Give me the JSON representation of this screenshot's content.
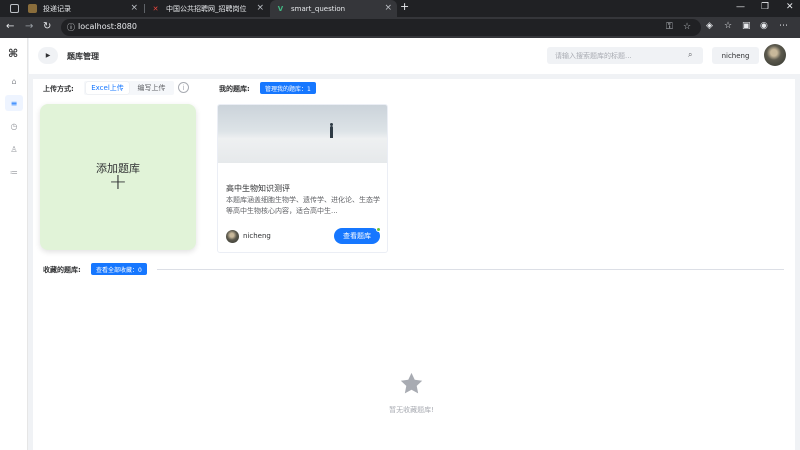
{
  "browser": {
    "tabs": [
      {
        "title": "投递记录",
        "active": false
      },
      {
        "title": "中国公共招聘网_招聘岗位",
        "active": false
      },
      {
        "title": "smart_question",
        "active": true
      }
    ],
    "new_tab": "+",
    "url": "localhost:8080"
  },
  "sidebar": {
    "logo": "⌘",
    "items": [
      {
        "icon": "home-icon",
        "glyph": "⌂",
        "active": false
      },
      {
        "icon": "list-icon",
        "glyph": "≡",
        "active": true
      },
      {
        "icon": "clock-icon",
        "glyph": "◷",
        "active": false
      },
      {
        "icon": "flask-icon",
        "glyph": "♙",
        "active": false
      },
      {
        "icon": "sort-icon",
        "glyph": "≔",
        "active": false
      }
    ]
  },
  "header": {
    "toggle_glyph": "▶",
    "title": "题库管理",
    "search_placeholder": "请输入搜索题库的标题...",
    "search_glyph": "⌕",
    "username": "nicheng"
  },
  "upload": {
    "label": "上传方式:",
    "options": [
      "Excel上传",
      "编写上传"
    ],
    "selected": "Excel上传",
    "info_glyph": "i"
  },
  "my_banks": {
    "label": "我的题库:",
    "manage_tag": "管理我的题库：1"
  },
  "add_card": {
    "label": "添加题库",
    "plus": "+"
  },
  "bank": {
    "title": "高中生物知识测评",
    "description": "本题库涵盖细胞生物学、遗传学、进化论、生态学等高中生物核心内容，适合高中生...",
    "owner": "nicheng",
    "view_label": "查看题库"
  },
  "favorites": {
    "label": "收藏的题库:",
    "view_all_tag": "查看全部收藏：0",
    "empty_text": "暂无收藏题库!"
  },
  "colors": {
    "primary": "#1677ff",
    "add_card_bg": "#e1f3d8",
    "status_online": "#67c23a"
  }
}
